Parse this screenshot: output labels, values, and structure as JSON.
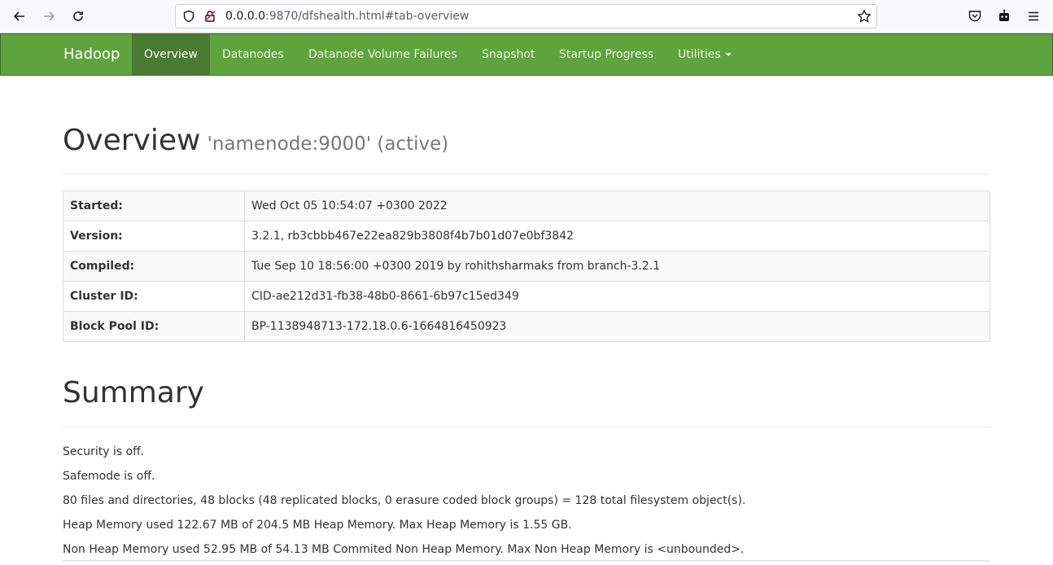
{
  "browser": {
    "url_host": "0.0.0.0",
    "url_rest": ":9870/dfshealth.html#tab-overview"
  },
  "navbar": {
    "brand": "Hadoop",
    "items": [
      {
        "label": "Overview",
        "active": true
      },
      {
        "label": "Datanodes",
        "active": false
      },
      {
        "label": "Datanode Volume Failures",
        "active": false
      },
      {
        "label": "Snapshot",
        "active": false
      },
      {
        "label": "Startup Progress",
        "active": false
      },
      {
        "label": "Utilities",
        "active": false
      }
    ],
    "color": "#5fa33e"
  },
  "overview": {
    "title": "Overview",
    "subtitle": "'namenode:9000' (active)",
    "rows": [
      {
        "label": "Started:",
        "value": "Wed Oct 05 10:54:07 +0300 2022"
      },
      {
        "label": "Version:",
        "value": "3.2.1, rb3cbbb467e22ea829b3808f4b7b01d07e0bf3842"
      },
      {
        "label": "Compiled:",
        "value": "Tue Sep 10 18:56:00 +0300 2019 by rohithsharmaks from branch-3.2.1"
      },
      {
        "label": "Cluster ID:",
        "value": "CID-ae212d31-fb38-48b0-8661-6b97c15ed349"
      },
      {
        "label": "Block Pool ID:",
        "value": "BP-1138948713-172.18.0.6-1664816450923"
      }
    ]
  },
  "summary": {
    "title": "Summary",
    "lines": [
      "Security is off.",
      "Safemode is off.",
      "80 files and directories, 48 blocks (48 replicated blocks, 0 erasure coded block groups) = 128 total filesystem object(s).",
      "Heap Memory used 122.67 MB of 204.5 MB Heap Memory. Max Heap Memory is 1.55 GB.",
      "Non Heap Memory used 52.95 MB of 54.13 MB Commited Non Heap Memory. Max Non Heap Memory is <unbounded>."
    ]
  }
}
